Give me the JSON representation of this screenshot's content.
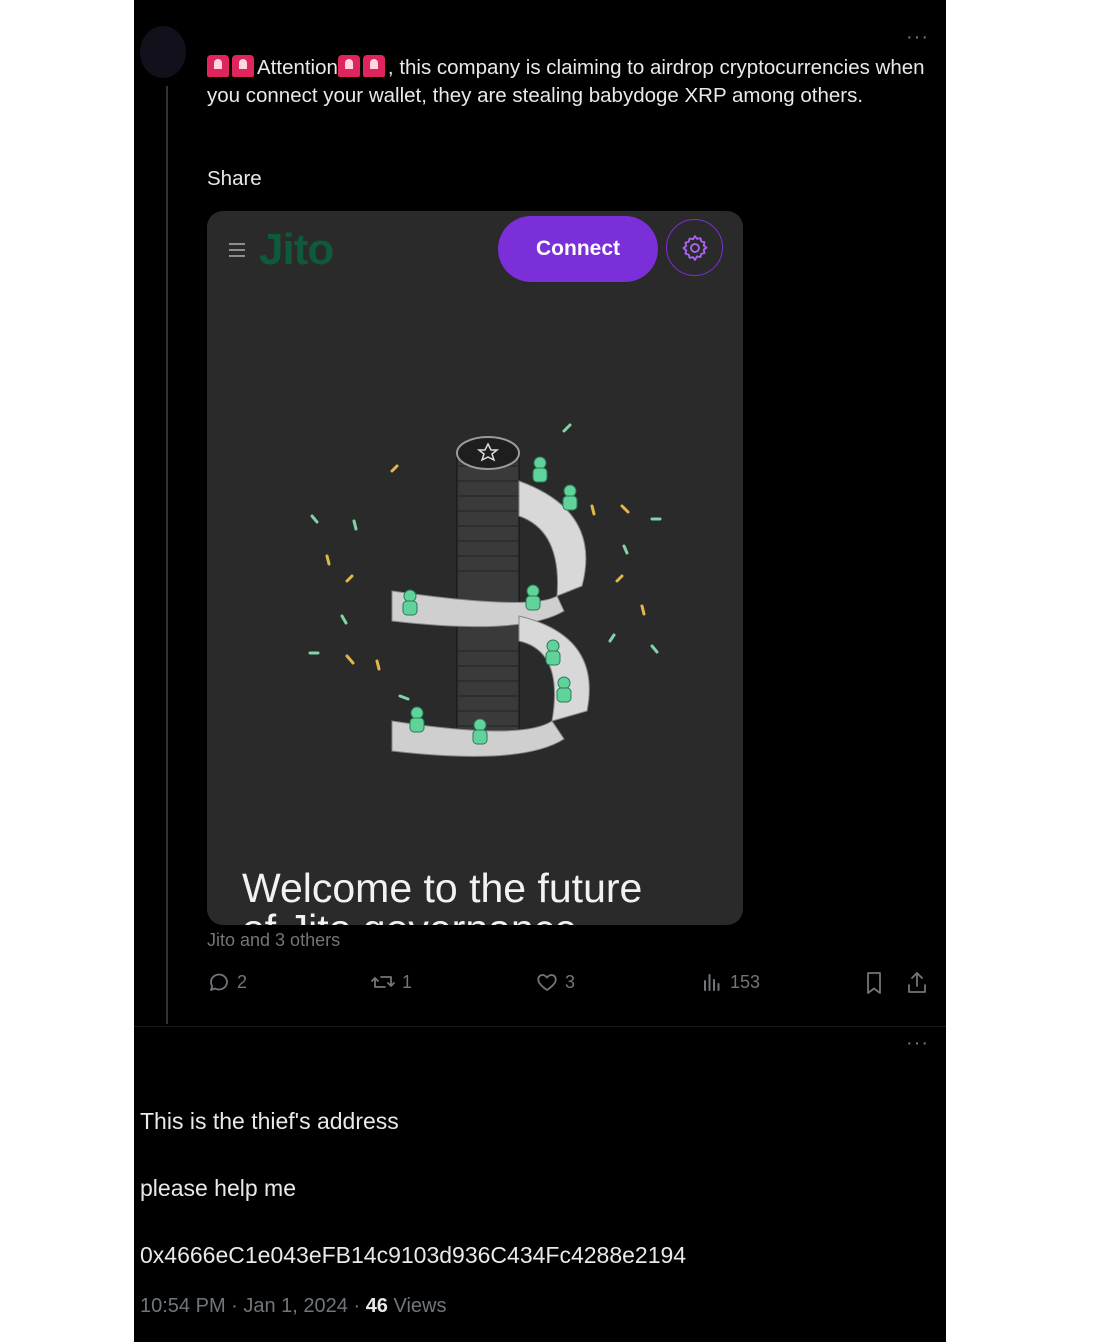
{
  "post": {
    "text_before": "Attention",
    "text_after": ", this company is claiming to airdrop cryptocurrencies when you connect your wallet, they are stealing babydoge XRP among others.",
    "share_text": "Share",
    "tagged": "Jito and 3 others",
    "more_label": "···"
  },
  "embedded_image": {
    "logo": "Jito",
    "connect_label": "Connect",
    "settings_icon": "gear-icon",
    "heading_line1": "Welcome to the future",
    "heading_line2": "of Jito governance"
  },
  "actions": {
    "replies": "2",
    "reposts": "1",
    "likes": "3",
    "views": "153"
  },
  "reply": {
    "more_label": "···",
    "line1": "This is the thief's address",
    "line2": "please help me",
    "address": "0x4666eC1e043eFB14c9103d936C434Fc4288e2194",
    "time": "10:54 PM · Jan 1, 2024 · ",
    "views_count": "46",
    "views_label": " Views"
  },
  "colors": {
    "accent_purple": "#7b2fd8",
    "siren_red": "#e0245e",
    "text_primary": "#e7e9ea",
    "text_secondary": "#71767b"
  }
}
